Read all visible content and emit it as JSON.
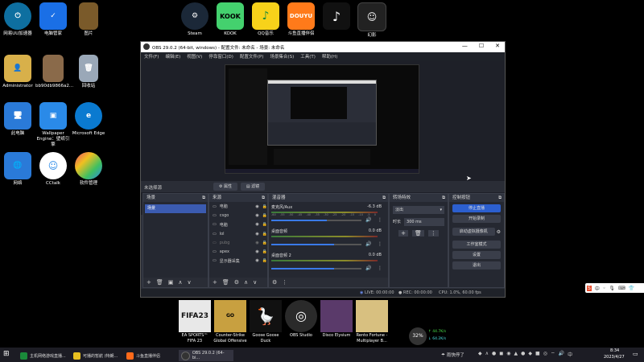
{
  "desktop": {
    "top_icons": [
      {
        "label": "网易UU加速器",
        "icon": "uu-icon",
        "color": "#1a8fc9"
      },
      {
        "label": "电脑管家",
        "icon": "shield-icon",
        "color": "#1a6fe6"
      },
      {
        "label": "图片",
        "icon": "picture-icon",
        "color": "#7a5a2a"
      },
      {
        "label": "Steam",
        "icon": "steam-icon",
        "color": "#1b2838"
      },
      {
        "label": "KOOK",
        "icon": "kook-icon",
        "color": "#44d16e"
      },
      {
        "label": "QQ音乐",
        "icon": "music-icon",
        "color": "#f7d21a"
      },
      {
        "label": "斗鱼直播伴侣",
        "icon": "douyu-icon",
        "color": "#ff7a1a"
      },
      {
        "label": "",
        "icon": "tiktok-icon",
        "color": "#111111"
      },
      {
        "label": "幻影",
        "icon": "ghost-icon",
        "color": "#222222"
      }
    ],
    "left_icons": [
      {
        "label": "Administrator",
        "icon": "user-folder-icon",
        "color": "#d8b04a"
      },
      {
        "label": "bb90db9866a2...",
        "icon": "image-file-icon",
        "color": "#8a6a4a"
      },
      {
        "label": "回收站",
        "icon": "recycle-bin-icon",
        "color": "#6a7a8a"
      },
      {
        "label": "此电脑",
        "icon": "computer-icon",
        "color": "#2a7ad8"
      },
      {
        "label": "Wallpaper Engine：壁纸引擎",
        "icon": "wallpaper-icon",
        "color": "#2a8ae8"
      },
      {
        "label": "Microsoft Edge",
        "icon": "edge-icon",
        "color": "#0a7ad0"
      },
      {
        "label": "网络",
        "icon": "network-icon",
        "color": "#2a7ad8"
      },
      {
        "label": "CCtalk",
        "icon": "cctalk-icon",
        "color": "#2a8ae8"
      },
      {
        "label": "软件管理",
        "icon": "app-manager-icon",
        "color": "#e84a6a"
      }
    ],
    "bottom_icons": [
      {
        "label": "EA SPORTS™ FIFA 23",
        "icon": "fifa-icon",
        "color": "#e8e8e8"
      },
      {
        "label": "Counter-Strike Global Offensive",
        "icon": "csgo-icon",
        "color": "#c8a040"
      },
      {
        "label": "Goose Goose Duck",
        "icon": "goose-icon",
        "color": "#f0f0f0"
      },
      {
        "label": "OBS Studio",
        "icon": "obs-icon",
        "color": "#2a2a2a"
      },
      {
        "label": "Disco Elysium",
        "icon": "disco-icon",
        "color": "#5a3a6a"
      },
      {
        "label": "Rento Fortune - Multiplayer B...",
        "icon": "rento-icon",
        "color": "#d8c080"
      }
    ],
    "net_widget": {
      "percent": "32%",
      "up": "↑ 44.7K/s",
      "down": "↓ 64.2K/s"
    }
  },
  "obs": {
    "title": "OBS 29.0.2 (64-bit, windows) - 配置文件: 未命名 - 场景: 未命名",
    "menu": [
      "文件(F)",
      "编辑(E)",
      "视图(V)",
      "停靠窗口(D)",
      "配置文件(P)",
      "场景集合(S)",
      "工具(T)",
      "帮助(H)"
    ],
    "no_source_label": "未选择源",
    "props_btn": "属性",
    "filter_btn": "滤镜",
    "docks": {
      "scenes": {
        "title": "场景",
        "items": [
          "场景"
        ]
      },
      "sources": {
        "title": "来源",
        "items": [
          "电脑",
          "csgo",
          "电脑",
          "lol",
          "pubg",
          "apex",
          "显示器采集"
        ]
      },
      "mixer": {
        "title": "混音器",
        "channels": [
          {
            "name": "麦克风/Aux",
            "db": "-6.3 dB",
            "level": 0.62
          },
          {
            "name": "桌面音频",
            "db": "0.0 dB",
            "level": 0.7
          },
          {
            "name": "桌面音频 2",
            "db": "0.0 dB",
            "level": 0.7
          }
        ],
        "ticks": [
          "-60",
          "-55",
          "-50",
          "-45",
          "-40",
          "-35",
          "-30",
          "-25",
          "-20",
          "-15",
          "-10",
          "-5",
          "0"
        ]
      },
      "transitions": {
        "title": "转场特效",
        "type": "淡出",
        "duration_label": "时长",
        "duration": "300 ms"
      },
      "controls": {
        "title": "控制按钮",
        "buttons": [
          "停止直播",
          "开始录制",
          "启动虚拟摄像机",
          "工作室模式",
          "设置",
          "退出"
        ]
      }
    },
    "status": {
      "live": "LIVE: 00:00:00",
      "rec": "REC: 00:00:00",
      "cpu": "CPU: 1.0%, 60.00 fps"
    }
  },
  "taskbar": {
    "items": [
      {
        "label": "主机网络游戏直播...",
        "color": "#1a8a3a"
      },
      {
        "label": "可播的暂航 (特朗...",
        "color": "#e8c020"
      },
      {
        "label": "斗鱼直播伴侣",
        "color": "#ff6a1a"
      },
      {
        "label": "OBS 29.0.2 (64-bi...",
        "color": "#333333"
      }
    ],
    "tray_text": "雨快停了",
    "time": "8:34",
    "date": "2023/4/27"
  }
}
